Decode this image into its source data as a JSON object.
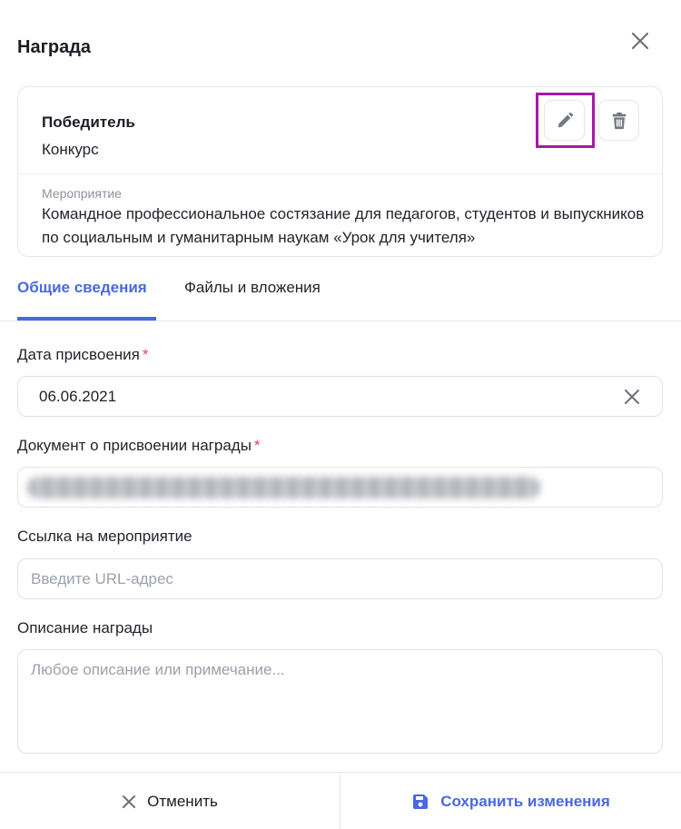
{
  "modal": {
    "title": "Награда",
    "close_icon": "close-icon"
  },
  "award_card": {
    "name": "Победитель",
    "type": "Конкурс",
    "event_label": "Мероприятие",
    "event_text": "Командное профессиональное состязание для педагогов, студентов и выпускников по социальным и гуманитарным наукам «Урок для учителя»",
    "edit_icon": "pencil-icon",
    "delete_icon": "trash-icon",
    "highlight_color": "#a51aa5"
  },
  "tabs": [
    {
      "label": "Общие сведения",
      "active": true
    },
    {
      "label": "Файлы и вложения",
      "active": false
    }
  ],
  "form": {
    "date": {
      "label": "Дата присвоения",
      "required_mark": "*",
      "value": "06.06.2021"
    },
    "document": {
      "label": "Документ о присвоении награды",
      "required_mark": "*"
    },
    "event_link": {
      "label": "Ссылка на мероприятие",
      "placeholder": "Введите URL-адрес"
    },
    "description": {
      "label": "Описание награды",
      "placeholder": "Любое описание или примечание..."
    }
  },
  "footer": {
    "cancel_label": "Отменить",
    "save_label": "Сохранить изменения",
    "cancel_icon": "close-icon",
    "save_icon": "floppy-disk-icon"
  },
  "colors": {
    "accent": "#4a68e0",
    "required": "#e0455b"
  }
}
